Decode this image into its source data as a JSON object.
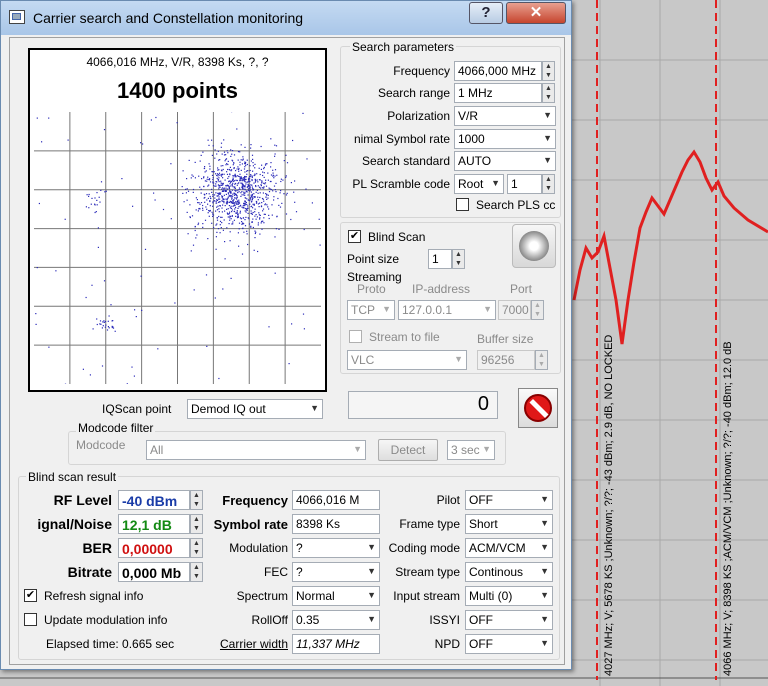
{
  "window": {
    "title": "Carrier search and Constellation monitoring",
    "help_label": "?",
    "close_label": "✕"
  },
  "constellation": {
    "info": "4066,016 MHz, V/R, 8398 Ks, ?, ?",
    "points_label": "1400 points"
  },
  "search": {
    "group_title": "Search parameters",
    "frequency_label": "Frequency",
    "frequency_value": "4066,000 MHz",
    "range_label": "Search range",
    "range_value": "1 MHz",
    "polarization_label": "Polarization",
    "polarization_value": "V/R",
    "symbol_rate_label": "nimal Symbol rate",
    "symbol_rate_value": "1000",
    "standard_label": "Search standard",
    "standard_value": "AUTO",
    "pl_label": "PL Scramble code",
    "pl_mode_value": "Root",
    "pl_code_value": "1",
    "search_pls_label": "Search PLS cc"
  },
  "blind": {
    "blind_scan_label": "Blind Scan",
    "blind_scan_checked": "✔",
    "point_size_label": "Point size",
    "point_size_value": "1",
    "streaming_title": "Streaming",
    "proto_label": "Proto",
    "ip_label": "IP-address",
    "port_label": "Port",
    "proto_value": "TCP",
    "ip_value": "127.0.0.1",
    "port_value": "7000",
    "stream_file_label": "Stream to file",
    "buffer_label": "Buffer size",
    "player_value": "VLC",
    "buffer_value": "96256"
  },
  "iq": {
    "label": "IQScan point",
    "value": "Demod IQ out",
    "counter": "0"
  },
  "modcode": {
    "group_title": "Modcode filter",
    "label": "Modcode",
    "value": "All",
    "detect_label": "Detect",
    "time_value": "3 sec"
  },
  "result": {
    "group_title": "Blind scan result",
    "rf_label": "RF Level",
    "rf_value": "-40 dBm",
    "sn_label": "ignal/Noise",
    "sn_value": "12,1 dB",
    "ber_label": "BER",
    "ber_value": "0,00000",
    "bitrate_label": "Bitrate",
    "bitrate_value": "0,000 Mb",
    "refresh_label": "Refresh signal info",
    "refresh_checked": "✔",
    "update_label": "Update modulation info",
    "elapsed": "Elapsed time: 0.665 sec",
    "frequency_label": "Frequency",
    "frequency_value": "4066,016 M",
    "symbol_label": "Symbol rate",
    "symbol_value": "8398 Ks",
    "modulation_label": "Modulation",
    "modulation_value": "?",
    "fec_label": "FEC",
    "fec_value": "?",
    "spectrum_label": "Spectrum",
    "spectrum_value": "Normal",
    "rolloff_label": "RollOff",
    "rolloff_value": "0.35",
    "carrier_label": "Carrier width",
    "carrier_value": "11,337 MHz",
    "pilot_label": "Pilot",
    "pilot_value": "OFF",
    "frame_label": "Frame type",
    "frame_value": "Short",
    "coding_label": "Coding mode",
    "coding_value": "ACM/VCM",
    "stream_type_label": "Stream type",
    "stream_type_value": "Continous",
    "input_label": "Input stream",
    "input_value": "Multi (0)",
    "issyi_label": "ISSYI",
    "issyi_value": "OFF",
    "npd_label": "NPD",
    "npd_value": "OFF"
  },
  "spectrum_bg": {
    "marker1": "4027 MHz; V; 5678 KS ;Unknown; ?/?; -43 dBm; 2.9 dB, NO LOCKED",
    "marker2": "4066 MHz; V; 8398 KS ;ACM/VCM ;Unknown; ?/?; -40 dBm; 12.0 dB"
  },
  "colors": {
    "trace": "#e02020",
    "rf_value": "#1a3ca8",
    "sn_value": "#138a13",
    "ber_value": "#d01010"
  }
}
